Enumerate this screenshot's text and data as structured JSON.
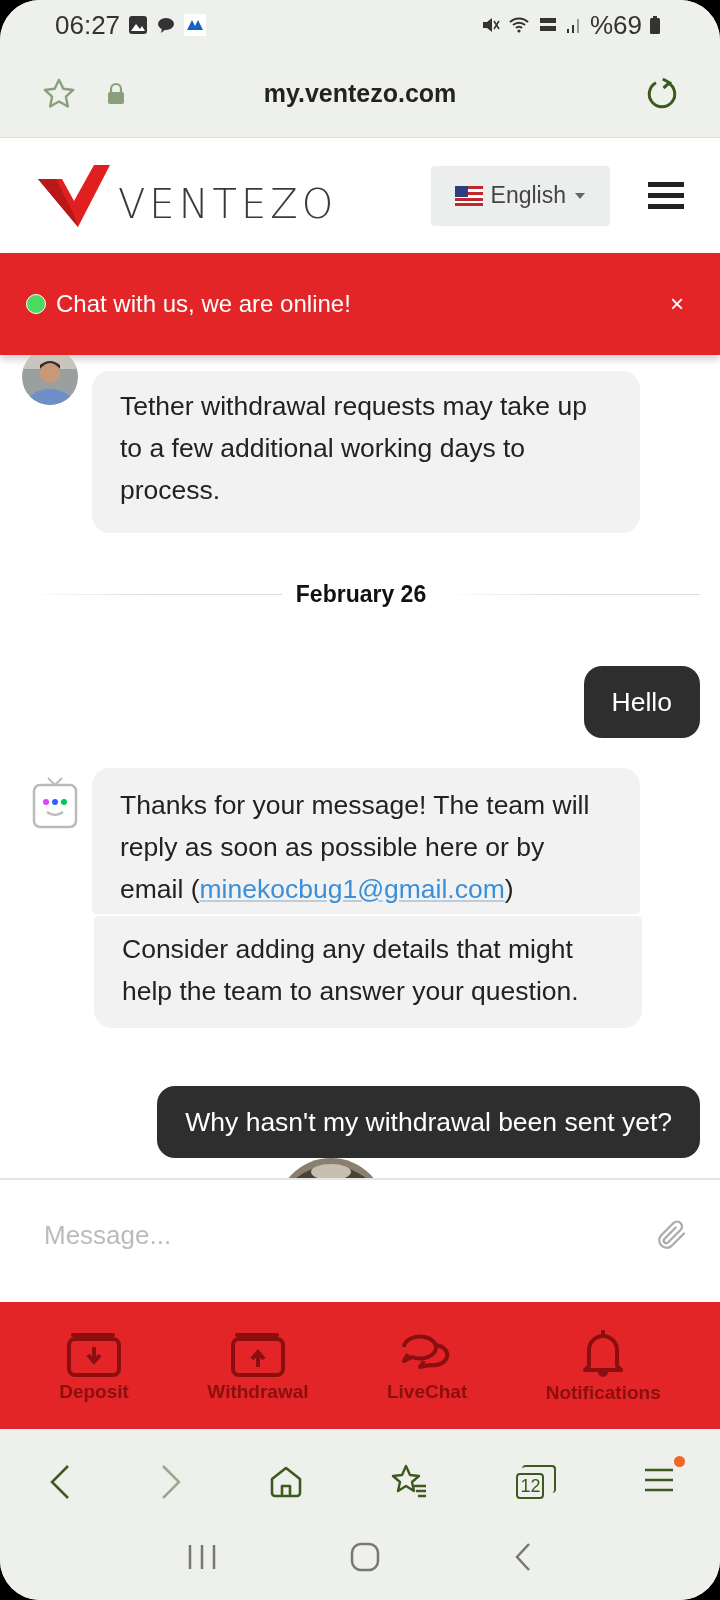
{
  "status_bar": {
    "time": "06:27",
    "battery": "%69"
  },
  "browser": {
    "url": "my.ventezo.com",
    "tab_count": "12"
  },
  "header": {
    "brand": "VENTEZO",
    "language": "English"
  },
  "banner": {
    "text": "Chat with us, we are online!",
    "close": "×"
  },
  "messages": [
    {
      "kind": "agent",
      "text": "Tether withdrawal requests may take up to a few additional working days to process."
    },
    {
      "kind": "date",
      "text": "February 26"
    },
    {
      "kind": "user",
      "text": "Hello"
    },
    {
      "kind": "bot",
      "text": "Thanks for your message! The team will reply as soon as possible here or by email (",
      "link": "minekocbug1@gmail.com",
      "after": ")"
    },
    {
      "kind": "bot-cont",
      "text": "Consider adding any details that might help the team to answer your question."
    },
    {
      "kind": "user",
      "text": "Why hasn't my withdrawal been sent yet?"
    },
    {
      "kind": "avatar-partial"
    }
  ],
  "composer": {
    "placeholder": "Message..."
  },
  "bottom_nav": [
    {
      "kind": "deposit",
      "label": "Deposit"
    },
    {
      "kind": "withdrawal",
      "label": "Withdrawal"
    },
    {
      "kind": "chat",
      "label": "LiveChat"
    },
    {
      "kind": "bell",
      "label": "Notifications"
    }
  ]
}
